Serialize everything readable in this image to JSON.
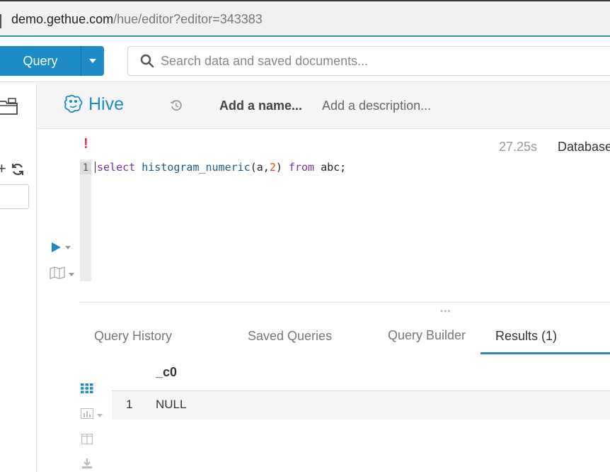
{
  "browser": {
    "url_host": "demo.gethue.com",
    "url_path": "/hue/editor?editor=343383"
  },
  "topbar": {
    "query_label": "Query",
    "search_placeholder": "Search data and saved documents..."
  },
  "editor": {
    "engine": "Hive",
    "name_placeholder": "Add a name...",
    "description_placeholder": "Add a description...",
    "error_mark": "!",
    "duration": "27.25s",
    "database_label": "Database",
    "line_number": "1",
    "code": {
      "kw_select": "select",
      "fn_name": "histogram_numeric",
      "args_open": "(a,",
      "arg_num": "2",
      "args_close": ") ",
      "kw_from": "from",
      "table": " abc;"
    }
  },
  "tabs": [
    {
      "label": "Query History",
      "active": false
    },
    {
      "label": "Saved Queries",
      "active": false
    },
    {
      "label": "Query Builder",
      "active": false
    },
    {
      "label": "Results (1)",
      "active": true
    }
  ],
  "results": {
    "columns": [
      "_c0"
    ],
    "rows": [
      {
        "index": "1",
        "values": [
          "NULL"
        ]
      }
    ]
  },
  "colors": {
    "accent": "#1c8bc6",
    "tab_underline": "#2e8ab8",
    "error": "#e2334b",
    "keyword": "#7b2fa6",
    "number": "#d64d11"
  },
  "icons": [
    "search-icon",
    "folder-icon",
    "plus-icon",
    "refresh-icon",
    "hive-logo-icon",
    "history-icon",
    "play-icon",
    "map-icon",
    "grid-icon",
    "chart-icon",
    "columns-icon",
    "download-icon"
  ]
}
